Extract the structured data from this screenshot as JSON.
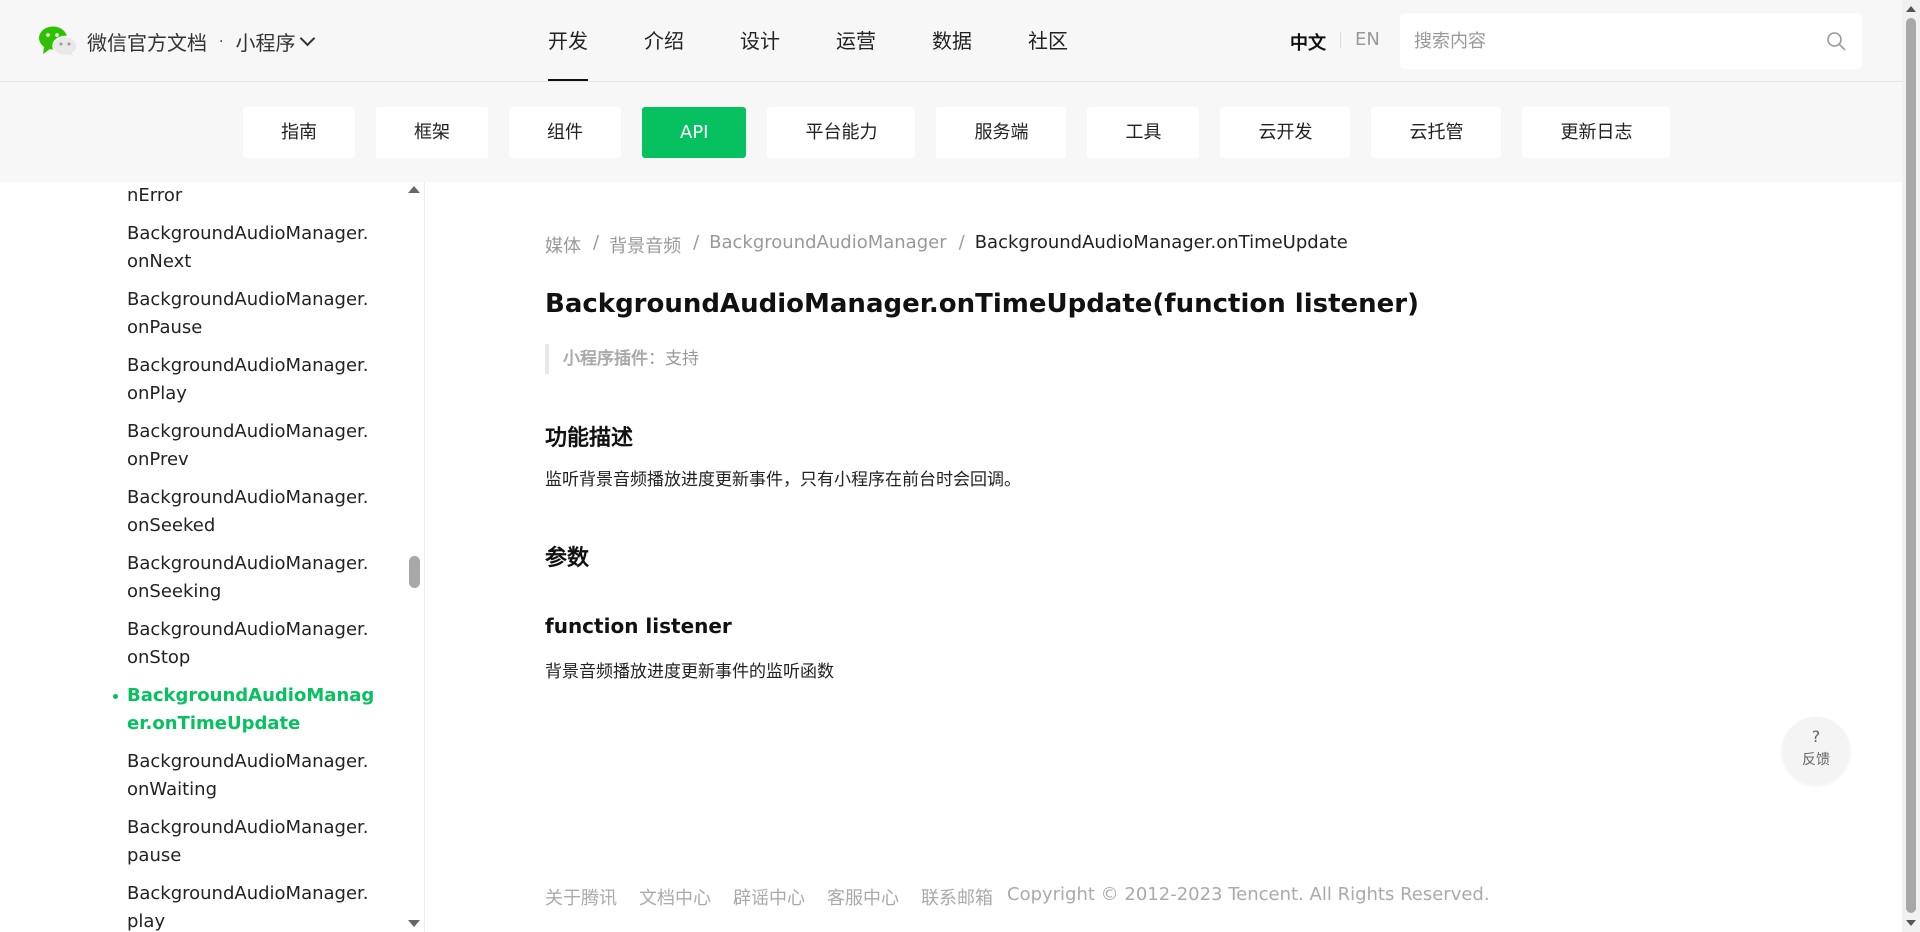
{
  "header": {
    "brand": "微信官方文档",
    "separator": "·",
    "product": "小程序",
    "nav": [
      "开发",
      "介绍",
      "设计",
      "运营",
      "数据",
      "社区"
    ],
    "active_nav": "开发",
    "lang_zh": "中文",
    "lang_en": "EN",
    "search_placeholder": "搜索内容"
  },
  "subnav": {
    "items": [
      "指南",
      "框架",
      "组件",
      "API",
      "平台能力",
      "服务端",
      "工具",
      "云开发",
      "云托管",
      "更新日志"
    ],
    "active": "API"
  },
  "sidebar": {
    "items": [
      "nError",
      "BackgroundAudioManager.onNext",
      "BackgroundAudioManager.onPause",
      "BackgroundAudioManager.onPlay",
      "BackgroundAudioManager.onPrev",
      "BackgroundAudioManager.onSeeked",
      "BackgroundAudioManager.onSeeking",
      "BackgroundAudioManager.onStop",
      "BackgroundAudioManager.onTimeUpdate",
      "BackgroundAudioManager.onWaiting",
      "BackgroundAudioManager.pause",
      "BackgroundAudioManager.play"
    ],
    "active": "BackgroundAudioManager.onTimeUpdate"
  },
  "content": {
    "breadcrumb": [
      "媒体",
      "背景音频",
      "BackgroundAudioManager",
      "BackgroundAudioManager.onTimeUpdate"
    ],
    "title": "BackgroundAudioManager.onTimeUpdate(function listener)",
    "plugin_label": "小程序插件",
    "plugin_value": "：支持",
    "desc_heading": "功能描述",
    "desc_text": "监听背景音频播放进度更新事件，只有小程序在前台时会回调。",
    "params_heading": "参数",
    "param_name": "function listener",
    "param_desc": "背景音频播放进度更新事件的监听函数"
  },
  "footer": {
    "links": [
      "关于腾讯",
      "文档中心",
      "辟谣中心",
      "客服中心",
      "联系邮箱"
    ],
    "copyright": "Copyright © 2012-2023 Tencent. All Rights Reserved."
  },
  "feedback": {
    "icon": "?",
    "label": "反馈"
  },
  "colors": {
    "accent": "#07c160",
    "header_bg": "#f7f7f7"
  }
}
